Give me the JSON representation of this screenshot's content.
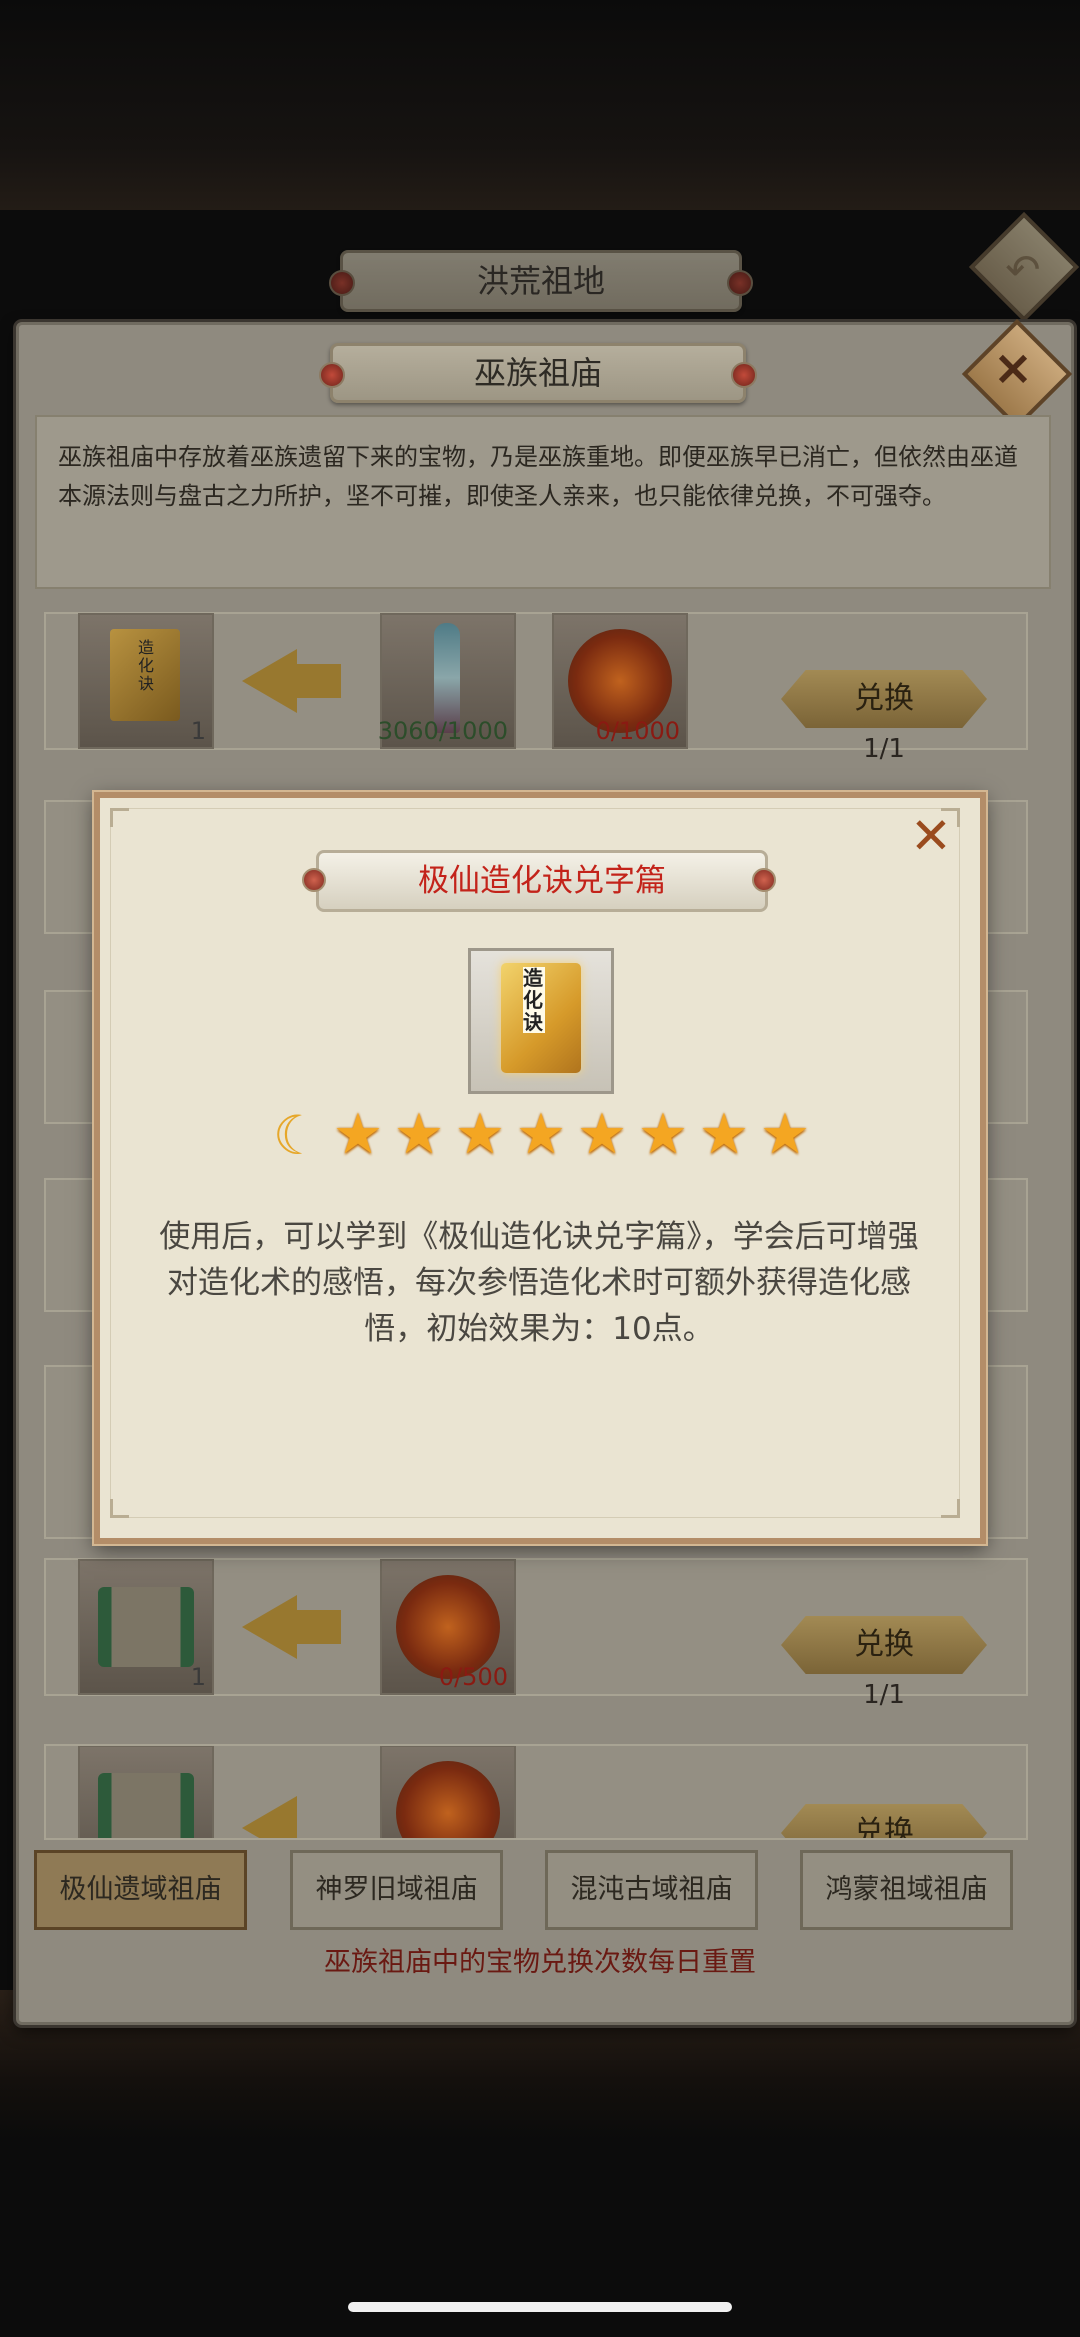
{
  "outer_header": {
    "title": "洪荒祖地"
  },
  "panel": {
    "title": "巫族祖庙",
    "description": "巫族祖庙中存放着巫族遗留下来的宝物，乃是巫族重地。即便巫族早已消亡，但依然由巫道本源法则与盘古之力所护，坚不可摧，即使圣人亲来，也只能依律兑换，不可强夺。"
  },
  "rows": [
    {
      "reward": {
        "icon": "book-icon",
        "label": "造化诀",
        "qty": "1"
      },
      "costs": [
        {
          "icon": "sword-icon",
          "qty": "3060/1000"
        },
        {
          "icon": "fire-emblem-icon",
          "qty": "0/1000"
        }
      ],
      "button": "兑换",
      "count": "1/1"
    },
    {
      "reward": {
        "icon": "scroll-icon",
        "qty": "1"
      },
      "costs": [
        {
          "icon": "fire-emblem-icon",
          "qty": "0/500"
        }
      ],
      "button": "兑换",
      "count": "1/1"
    },
    {
      "button": "兑换"
    }
  ],
  "tabs": [
    "极仙遗域祖庙",
    "神罗旧域祖庙",
    "混沌古域祖庙",
    "鸿蒙祖域祖庙"
  ],
  "active_tab": 0,
  "footer_note": "巫族祖庙中的宝物兑换次数每日重置",
  "popup": {
    "title": "极仙造化诀兑字篇",
    "item_label": "造化诀",
    "rating": {
      "moons": 1,
      "stars": 8
    },
    "description": "使用后，可以学到《极仙造化诀兑字篇》，学会后可增强对造化术的感悟，每次参悟造化术时可额外获得造化感悟，初始效果为：10点。",
    "close_glyph": "✕"
  },
  "colors": {
    "popup_title": "#c3231a",
    "accent": "#b38d68",
    "star": "#f4a622"
  }
}
